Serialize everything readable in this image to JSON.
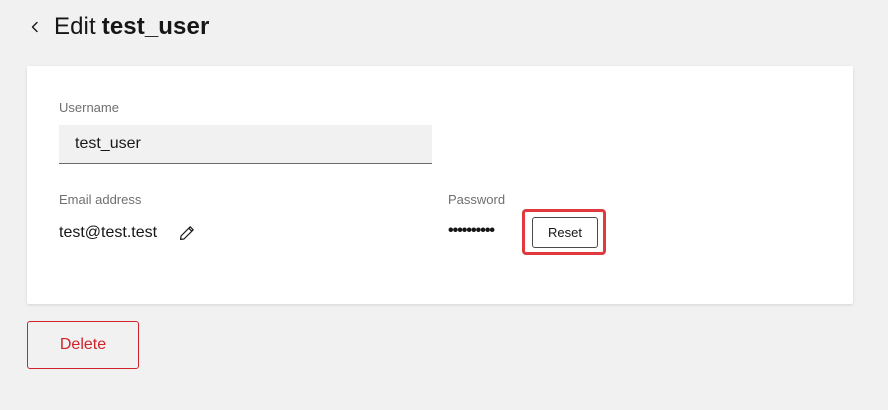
{
  "header": {
    "back_icon": "chevron-left-icon",
    "title_prefix": "Edit",
    "title_user": "test_user"
  },
  "form": {
    "username": {
      "label": "Username",
      "value": "test_user"
    },
    "email": {
      "label": "Email address",
      "value": "test@test.test",
      "edit_icon": "pencil-icon"
    },
    "password": {
      "label": "Password",
      "masked_value": "••••••••••",
      "reset_label": "Reset"
    }
  },
  "actions": {
    "delete_label": "Delete"
  },
  "colors": {
    "background": "#f2f1f1",
    "card": "#ffffff",
    "danger": "#d0222b",
    "highlight": "#e03a3e"
  }
}
